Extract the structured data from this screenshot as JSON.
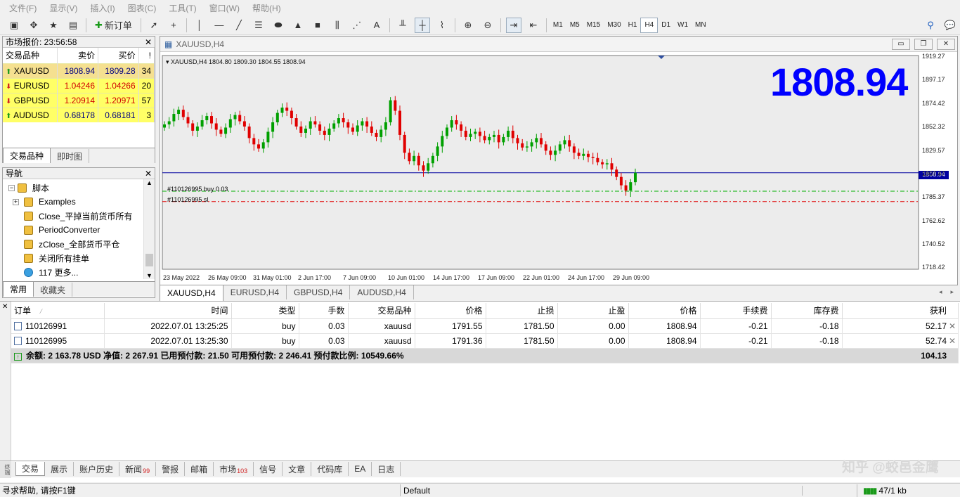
{
  "menu": [
    "文件(F)",
    "显示(V)",
    "插入(I)",
    "图表(C)",
    "工具(T)",
    "窗口(W)",
    "帮助(H)"
  ],
  "toolbar": {
    "new_order": "新订单",
    "timeframes": [
      "M1",
      "M5",
      "M15",
      "M30",
      "H1",
      "H4",
      "D1",
      "W1",
      "MN"
    ],
    "active_timeframe": "H4"
  },
  "market_watch": {
    "title": "市场报价: 23:56:58",
    "headers": {
      "symbol": "交易品种",
      "bid": "卖价",
      "ask": "买价",
      "spread": "!"
    },
    "rows": [
      {
        "symbol": "XAUUSD",
        "bid": "1808.94",
        "ask": "1809.28",
        "spread": "34",
        "dir": "up"
      },
      {
        "symbol": "EURUSD",
        "bid": "1.04246",
        "ask": "1.04266",
        "spread": "20",
        "dir": "down"
      },
      {
        "symbol": "GBPUSD",
        "bid": "1.20914",
        "ask": "1.20971",
        "spread": "57",
        "dir": "down"
      },
      {
        "symbol": "AUDUSD",
        "bid": "0.68178",
        "ask": "0.68181",
        "spread": "3",
        "dir": "up"
      }
    ],
    "tabs": [
      "交易品种",
      "即时图"
    ]
  },
  "navigator": {
    "title": "导航",
    "root": "脚本",
    "items": [
      "Examples",
      "Close_平掉当前货币所有",
      "PeriodConverter",
      "zClose_全部货币平仓",
      "关闭所有挂单",
      "117 更多..."
    ],
    "tabs": [
      "常用",
      "收藏夹"
    ]
  },
  "chart": {
    "window_title": "XAUUSD,H4",
    "info_line": "XAUUSD,H4  1804.80 1809.30 1804.55 1808.94",
    "big_price": "1808.94",
    "current_price_label": "1808.94",
    "order_buy_label": "#110126995 buy 0.03",
    "order_sl_label": "#110126995 sl",
    "price_axis": [
      "1919.27",
      "1897.17",
      "1874.42",
      "1852.32",
      "1829.57",
      "1807.47",
      "1785.37",
      "1762.62",
      "1740.52",
      "1718.42"
    ],
    "time_axis": [
      "23 May 2022",
      "26 May 09:00",
      "31 May 01:00",
      "2 Jun 17:00",
      "7 Jun 09:00",
      "10 Jun 01:00",
      "14 Jun 17:00",
      "17 Jun 09:00",
      "22 Jun 01:00",
      "24 Jun 17:00",
      "29 Jun 09:00"
    ],
    "tabs": [
      "XAUUSD,H4",
      "EURUSD,H4",
      "GBPUSD,H4",
      "AUDUSD,H4"
    ],
    "closes": [
      1855,
      1858,
      1865,
      1869,
      1862,
      1856,
      1849,
      1853,
      1859,
      1863,
      1856,
      1850,
      1846,
      1852,
      1860,
      1864,
      1858,
      1853,
      1842,
      1836,
      1832,
      1838,
      1848,
      1857,
      1866,
      1871,
      1868,
      1861,
      1853,
      1847,
      1851,
      1858,
      1855,
      1849,
      1845,
      1851,
      1856,
      1861,
      1857,
      1852,
      1848,
      1854,
      1858,
      1853,
      1847,
      1843,
      1850,
      1857,
      1878,
      1868,
      1845,
      1828,
      1820,
      1825,
      1816,
      1811,
      1818,
      1825,
      1834,
      1844,
      1852,
      1859,
      1855,
      1849,
      1843,
      1846,
      1848,
      1844,
      1840,
      1843,
      1845,
      1838,
      1843,
      1849,
      1842,
      1837,
      1833,
      1834,
      1838,
      1842,
      1836,
      1830,
      1826,
      1830,
      1836,
      1840,
      1834,
      1828,
      1825,
      1827,
      1824,
      1823,
      1819,
      1817,
      1818,
      1812,
      1805,
      1797,
      1792,
      1800,
      1808.94
    ]
  },
  "terminal": {
    "headers": [
      "订单",
      "时间",
      "类型",
      "手数",
      "交易品种",
      "价格",
      "止损",
      "止盈",
      "价格",
      "手续费",
      "库存费",
      "获利"
    ],
    "rows": [
      [
        "110126991",
        "2022.07.01 13:25:25",
        "buy",
        "0.03",
        "xauusd",
        "1791.55",
        "1781.50",
        "0.00",
        "1808.94",
        "-0.21",
        "-0.18",
        "52.17"
      ],
      [
        "110126995",
        "2022.07.01 13:25:30",
        "buy",
        "0.03",
        "xauusd",
        "1791.36",
        "1781.50",
        "0.00",
        "1808.94",
        "-0.21",
        "-0.18",
        "52.74"
      ]
    ],
    "summary": "余额: 2 163.78 USD  净值: 2 267.91  已用预付款: 21.50  可用预付款: 2 246.41  预付款比例: 10549.66%",
    "summary_profit": "104.13",
    "tabs": [
      {
        "label": "交易",
        "badge": ""
      },
      {
        "label": "展示",
        "badge": ""
      },
      {
        "label": "账户历史",
        "badge": ""
      },
      {
        "label": "新闻",
        "badge": "99"
      },
      {
        "label": "警报",
        "badge": ""
      },
      {
        "label": "邮箱",
        "badge": ""
      },
      {
        "label": "市场",
        "badge": "103"
      },
      {
        "label": "信号",
        "badge": ""
      },
      {
        "label": "文章",
        "badge": ""
      },
      {
        "label": "代码库",
        "badge": ""
      },
      {
        "label": "EA",
        "badge": ""
      },
      {
        "label": "日志",
        "badge": ""
      }
    ],
    "side_label": "终端"
  },
  "statusbar": {
    "help": "寻求帮助, 请按F1键",
    "profile": "Default",
    "traffic": "47/1 kb"
  },
  "watermark": "知乎 @蛟邑金鹰",
  "colors": {
    "bull": "#00a000",
    "bear": "#e00000",
    "price_line": "#0000a0",
    "big_price": "#0000ff",
    "mw_row": "#ffff66"
  }
}
